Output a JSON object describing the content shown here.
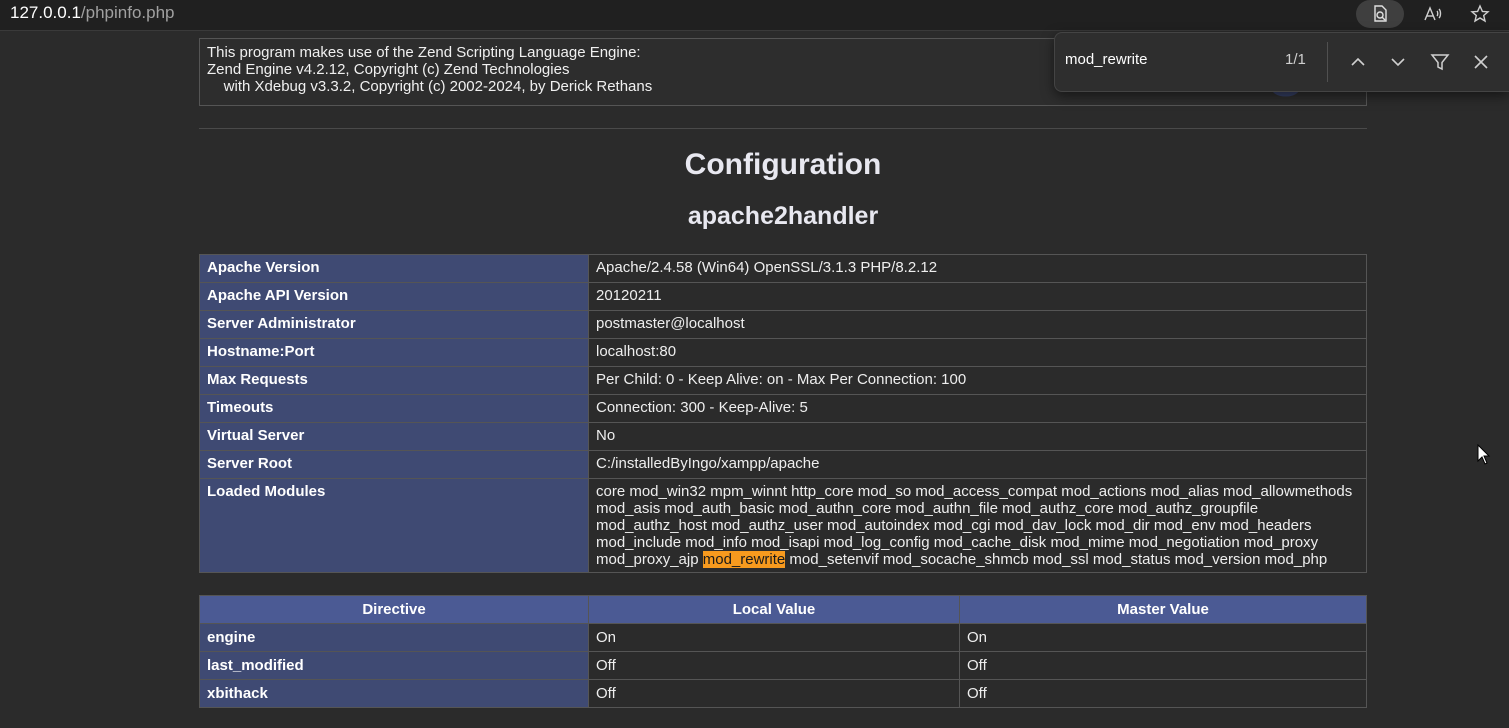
{
  "browser": {
    "url_host": "127.0.0.1",
    "url_path": "/phpinfo.php",
    "icons": [
      "page-search-icon",
      "read-aloud-icon",
      "favorite-star-icon"
    ]
  },
  "engine_info": {
    "line1": "This program makes use of the Zend Scripting Language Engine:",
    "line2": "Zend Engine v4.2.12, Copyright (c) Zend Technologies",
    "line3": "    with Xdebug v3.3.2, Copyright (c) 2002-2024, by Derick Rethans"
  },
  "page": {
    "title": "Configuration",
    "section": "apache2handler"
  },
  "info_table": [
    {
      "key": "Apache Version",
      "value": "Apache/2.4.58 (Win64) OpenSSL/3.1.3 PHP/8.2.12"
    },
    {
      "key": "Apache API Version",
      "value": "20120211"
    },
    {
      "key": "Server Administrator",
      "value": "postmaster@localhost"
    },
    {
      "key": "Hostname:Port",
      "value": "localhost:80"
    },
    {
      "key": "Max Requests",
      "value": "Per Child: 0 - Keep Alive: on - Max Per Connection: 100"
    },
    {
      "key": "Timeouts",
      "value": "Connection: 300 - Keep-Alive: 5"
    },
    {
      "key": "Virtual Server",
      "value": "No"
    },
    {
      "key": "Server Root",
      "value": "C:/installedByIngo/xampp/apache"
    }
  ],
  "modules": {
    "key": "Loaded Modules",
    "line1": "core mod_win32 mpm_winnt http_core mod_so mod_access_compat mod_actions mod_alias mod_allowmethods",
    "line2": "mod_asis mod_auth_basic mod_authn_core mod_authn_file mod_authz_core mod_authz_groupfile",
    "line3": "mod_authz_host mod_authz_user mod_autoindex mod_cgi mod_dav_lock mod_dir mod_env mod_headers",
    "line4": "mod_include mod_info mod_isapi mod_log_config mod_cache_disk mod_mime mod_negotiation mod_proxy",
    "line5_before": "mod_proxy_ajp ",
    "line5_highlight": "mod_rewrite",
    "line5_after": " mod_setenvif mod_socache_shmcb mod_ssl mod_status mod_version mod_php"
  },
  "directive_table": {
    "headers": [
      "Directive",
      "Local Value",
      "Master Value"
    ],
    "rows": [
      {
        "directive": "engine",
        "local": "On",
        "master": "On"
      },
      {
        "directive": "last_modified",
        "local": "Off",
        "master": "Off"
      },
      {
        "directive": "xbithack",
        "local": "Off",
        "master": "Off"
      }
    ]
  },
  "find_bar": {
    "query": "mod_rewrite",
    "count": "1/1",
    "icons": [
      "chevron-up-icon",
      "chevron-down-icon",
      "filter-icon",
      "close-icon"
    ]
  },
  "colors": {
    "row_header_bg": "#3f4a73",
    "table_header_bg": "#4b5a94",
    "highlight": "#f79a1e",
    "page_bg": "#2b2b2b"
  }
}
